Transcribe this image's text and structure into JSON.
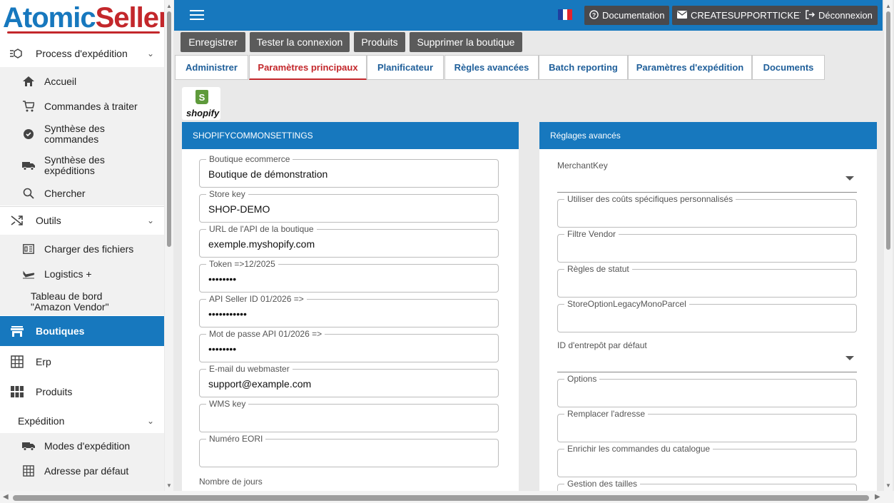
{
  "brand": {
    "part1": "Atomic",
    "part2": "Seller"
  },
  "sidebar": {
    "process_label": "Process d'expédition",
    "process_items": [
      {
        "label": "Accueil",
        "icon": "home-icon"
      },
      {
        "label": "Commandes à traiter",
        "icon": "cart-icon"
      },
      {
        "label": "Synthèse des commandes",
        "icon": "gear-badge-icon"
      },
      {
        "label": "Synthèse des expéditions",
        "icon": "truck-icon"
      },
      {
        "label": "Chercher",
        "icon": "search-icon"
      }
    ],
    "tools_label": "Outils",
    "tools_items": [
      {
        "label": "Charger des fichiers",
        "icon": "file-icon"
      },
      {
        "label": "Logistics +",
        "icon": "plane-icon"
      },
      {
        "label": "Tableau de bord \"Amazon Vendor\""
      }
    ],
    "boutiques_label": "Boutiques",
    "erp_label": "Erp",
    "produits_label": "Produits",
    "expedition_label": "Expédition",
    "expedition_items": [
      {
        "label": "Modes d'expédition",
        "icon": "truck-icon"
      },
      {
        "label": "Adresse par défaut",
        "icon": "grid-icon"
      }
    ]
  },
  "topbar": {
    "documentation": "Documentation",
    "support": "CREATESUPPORTTICKET",
    "logout": "Déconnexion",
    "flag_colors": [
      "#1f3fa0",
      "#ffffff",
      "#e4232c"
    ]
  },
  "actions": [
    "Enregistrer",
    "Tester la connexion",
    "Produits",
    "Supprimer la boutique"
  ],
  "tabs": [
    "Administrer",
    "Paramètres principaux",
    "Planificateur",
    "Règles avancées",
    "Batch reporting",
    "Paramètres d'expédition",
    "Documents"
  ],
  "active_tab": "Paramètres principaux",
  "shopify_logo": {
    "letter": "S",
    "word": "shopify"
  },
  "left_panel": {
    "title": "SHOPIFYCOMMONSETTINGS",
    "fields": [
      {
        "label": "Boutique ecommerce",
        "value": "Boutique de démonstration"
      },
      {
        "label": "Store key",
        "value": "SHOP-DEMO"
      },
      {
        "label": "URL de l'API de la boutique",
        "value": "exemple.myshopify.com"
      },
      {
        "label": "Token =>12/2025",
        "value": "••••••••"
      },
      {
        "label": "API Seller ID 01/2026 =>",
        "value": "•••••••••••"
      },
      {
        "label": "Mot de passe API 01/2026 =>",
        "value": "••••••••"
      },
      {
        "label": "E-mail du webmaster",
        "value": "support@example.com"
      },
      {
        "label": "WMS key",
        "value": ""
      },
      {
        "label": "Numéro EORI",
        "value": ""
      }
    ],
    "days_label": "Nombre de jours"
  },
  "right_panel": {
    "title": "Réglages avancés",
    "merchant_key_label": "MerchantKey",
    "fields_a": [
      {
        "label": "Utiliser des coûts spécifiques personnalisés",
        "value": ""
      },
      {
        "label": "Filtre Vendor",
        "value": ""
      },
      {
        "label": "Règles de statut",
        "value": ""
      },
      {
        "label": "StoreOptionLegacyMonoParcel",
        "value": ""
      }
    ],
    "warehouse_label": "ID d'entrepôt par défaut",
    "fields_b": [
      {
        "label": "Options",
        "value": ""
      },
      {
        "label": "Remplacer l'adresse",
        "value": ""
      },
      {
        "label": "Enrichir les commandes du catalogue",
        "value": ""
      },
      {
        "label": "Gestion des tailles",
        "value": ""
      }
    ]
  }
}
